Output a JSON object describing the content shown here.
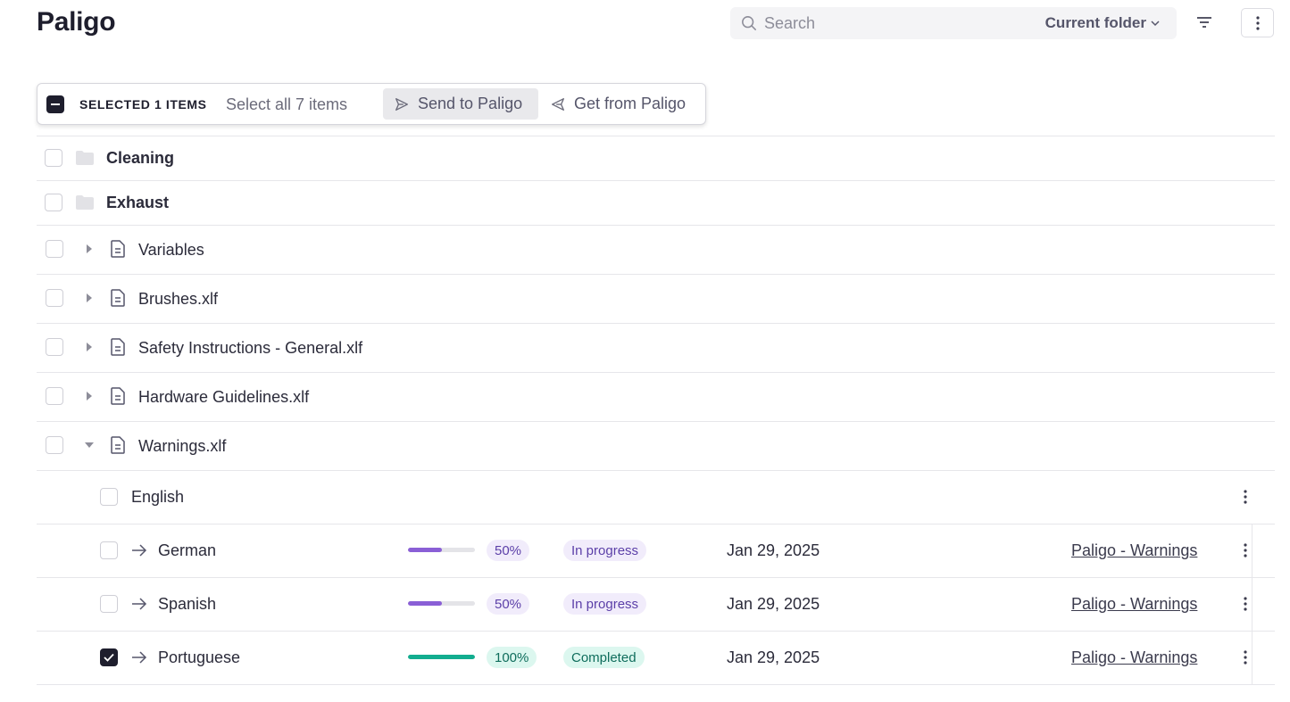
{
  "app": {
    "title": "Paligo"
  },
  "search": {
    "placeholder": "Search",
    "scope": "Current folder"
  },
  "icons": {
    "search": "search-icon",
    "filter": "filter-icon",
    "more": "more-vertical-icon",
    "send": "send-icon",
    "get": "receive-icon",
    "folder": "folder-icon",
    "document": "document-icon",
    "arrow": "arrow-right-icon",
    "caret_right": "caret-right-icon",
    "caret_down": "caret-down-icon"
  },
  "selection": {
    "count_label": "SELECTED 1 ITEMS",
    "select_all_label": "Select all 7 items",
    "send_label": "Send to Paligo",
    "get_label": "Get from Paligo"
  },
  "folders": [
    {
      "name": "Cleaning"
    },
    {
      "name": "Exhaust"
    }
  ],
  "files": [
    {
      "name": "Variables",
      "expanded": false
    },
    {
      "name": "Brushes.xlf",
      "expanded": false
    },
    {
      "name": "Safety Instructions - General.xlf",
      "expanded": false
    },
    {
      "name": "Hardware Guidelines.xlf",
      "expanded": false
    },
    {
      "name": "Warnings.xlf",
      "expanded": true
    }
  ],
  "source_language": {
    "name": "English"
  },
  "translations": [
    {
      "language": "German",
      "progress": 50,
      "progress_label": "50%",
      "status": "In progress",
      "date": "Jan 29, 2025",
      "target": "Paligo - Warnings",
      "checked": false
    },
    {
      "language": "Spanish",
      "progress": 50,
      "progress_label": "50%",
      "status": "In progress",
      "date": "Jan 29, 2025",
      "target": "Paligo - Warnings",
      "checked": false
    },
    {
      "language": "Portuguese",
      "progress": 100,
      "progress_label": "100%",
      "status": "Completed",
      "date": "Jan 29, 2025",
      "target": "Paligo - Warnings",
      "checked": true
    }
  ],
  "colors": {
    "in_progress_fill": "#8a5fd6",
    "in_progress_badge_bg": "#f1ecfb",
    "in_progress_text": "#5b3fa8",
    "completed_fill": "#12ad8f",
    "completed_badge_bg": "#dcf7ef",
    "completed_text": "#0f6d5c",
    "checkbox_dark": "#1e1e2d"
  }
}
